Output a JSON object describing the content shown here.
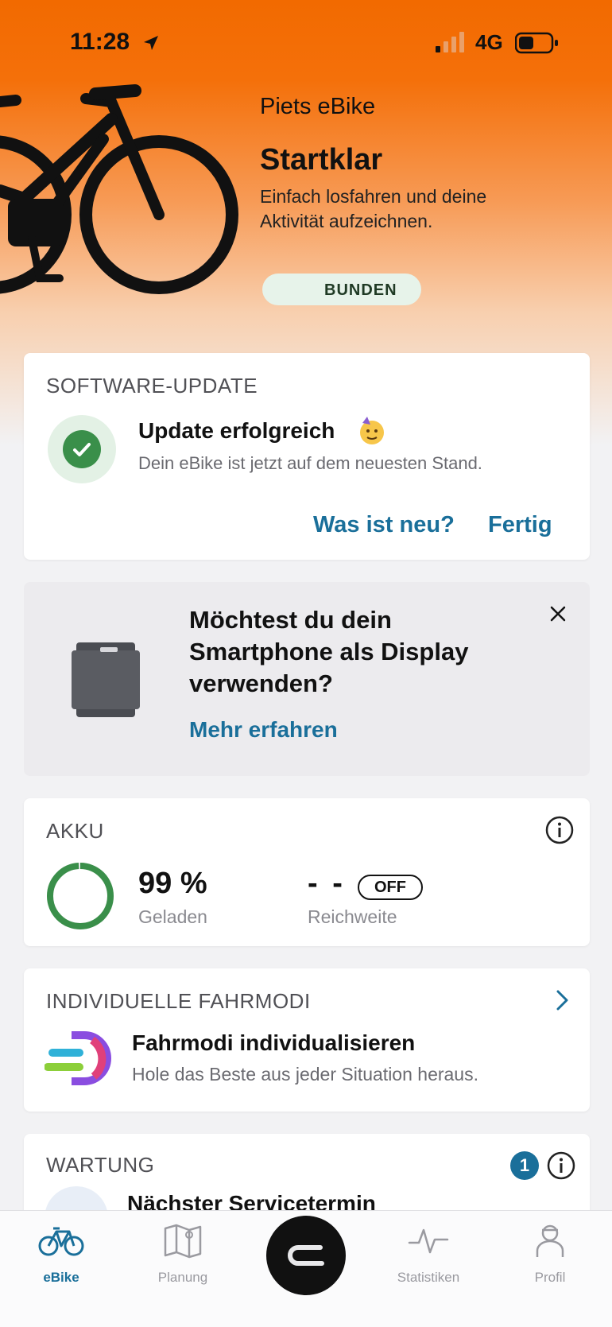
{
  "status_bar": {
    "time": "11:28",
    "network": "4G"
  },
  "header": {
    "bike_name": "Piets eBike",
    "status": "Startklar",
    "description": "Einfach losfahren und deine Aktivität aufzeichnen.",
    "connection_badge": "BUNDEN"
  },
  "update_card": {
    "title": "SOFTWARE-UPDATE",
    "heading": "Update erfolgreich",
    "message": "Dein eBike ist jetzt auf dem neuesten Stand.",
    "whats_new_label": "Was ist neu?",
    "done_label": "Fertig"
  },
  "display_card": {
    "title": "Möchtest du dein Smartphone als Display verwenden?",
    "link": "Mehr erfahren"
  },
  "akku_card": {
    "title": "AKKU",
    "charge_value": "99 %",
    "charge_label": "Geladen",
    "charge_fraction": 0.99,
    "range_value": "- -",
    "range_mode": "OFF",
    "range_label": "Reichweite"
  },
  "modes_card": {
    "title": "INDIVIDUELLE FAHRMODI",
    "heading": "Fahrmodi individualisieren",
    "description": "Hole das Beste aus jeder Situation heraus."
  },
  "service_card": {
    "title": "WARTUNG",
    "badge": "1",
    "heading": "Nächster Servicetermin"
  },
  "tabbar": {
    "tabs": [
      {
        "label": "eBike",
        "icon": "bike-icon",
        "active": true
      },
      {
        "label": "Planung",
        "icon": "map-icon",
        "active": false
      },
      {
        "label": "",
        "icon": "ride-icon",
        "active": false
      },
      {
        "label": "Statistiken",
        "icon": "pulse-icon",
        "active": false
      },
      {
        "label": "Profil",
        "icon": "profile-icon",
        "active": false
      }
    ]
  },
  "colors": {
    "brand_orange": "#f26a00",
    "accent_blue": "#1a6f9a",
    "success_green": "#3a8f4a"
  }
}
